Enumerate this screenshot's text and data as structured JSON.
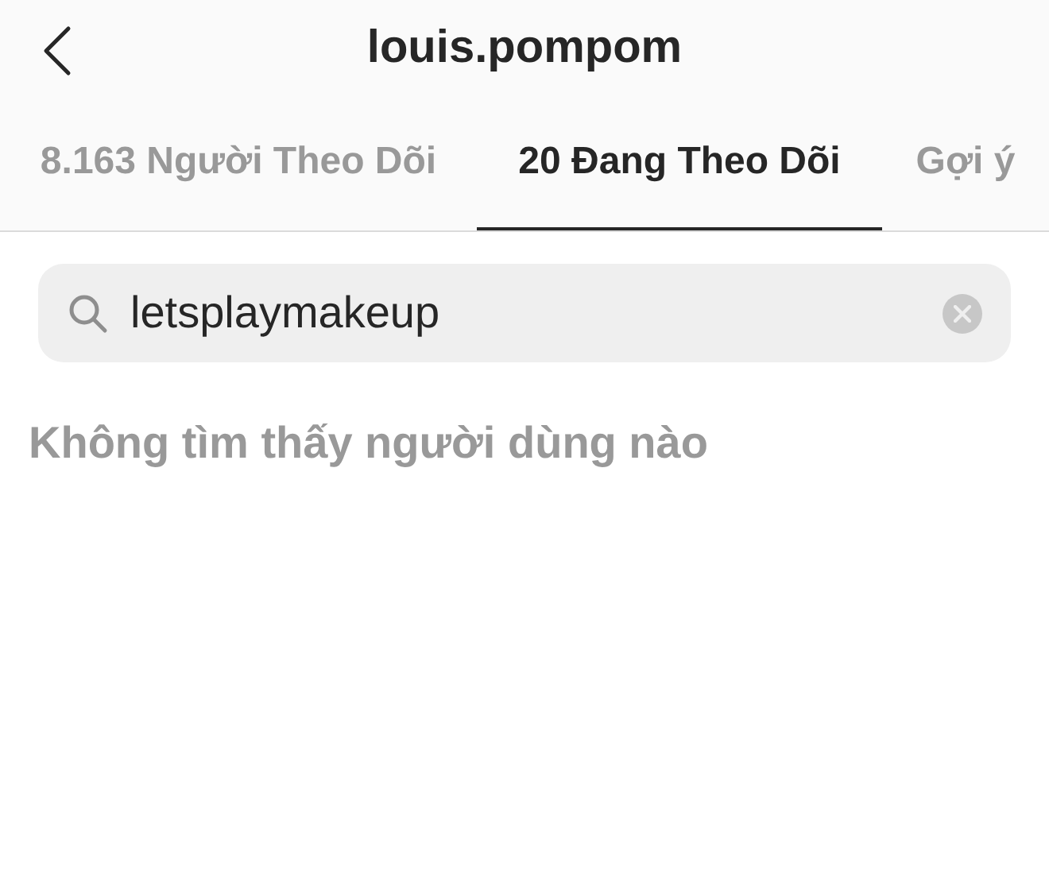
{
  "header": {
    "title": "louis.pompom"
  },
  "tabs": [
    {
      "label": "8.163 Người Theo Dõi",
      "selected": false
    },
    {
      "label": "20 Đang Theo Dõi",
      "selected": true
    },
    {
      "label": "Gợi ý",
      "selected": false
    }
  ],
  "search": {
    "value": "letsplaymakeup"
  },
  "message": "Không tìm thấy người dùng nào"
}
